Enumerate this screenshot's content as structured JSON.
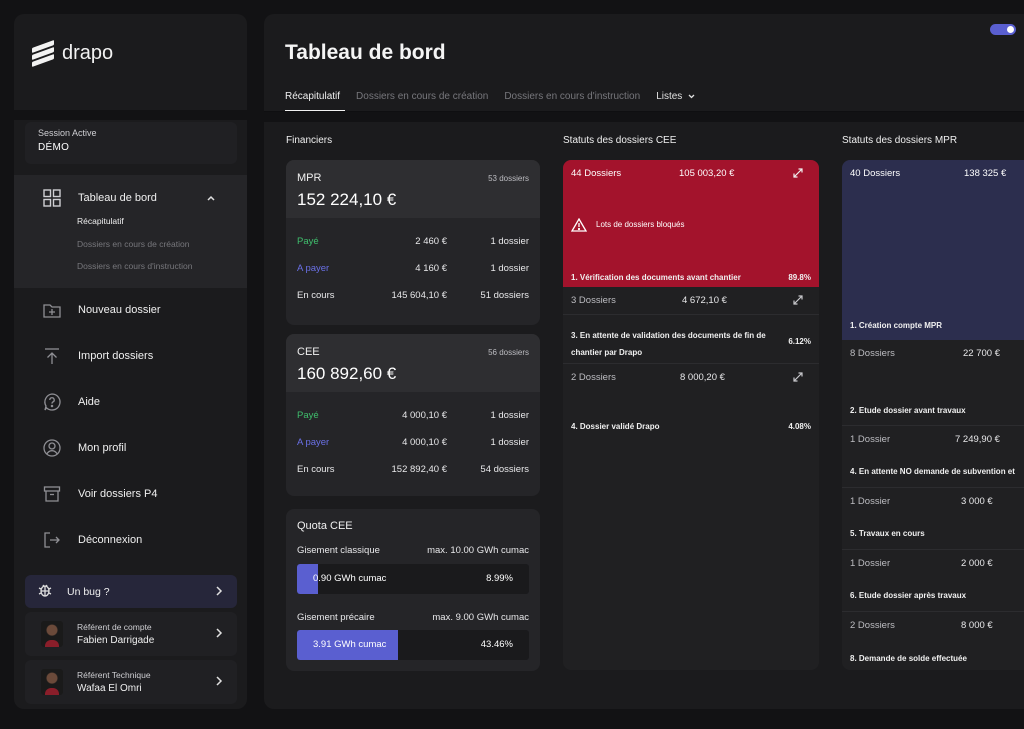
{
  "app": {
    "logo_text": "drapo"
  },
  "session": {
    "label": "Session Active",
    "value": "DÉMO"
  },
  "nav": {
    "dashboard": {
      "label": "Tableau de bord",
      "icon": "grid-icon"
    },
    "sub": [
      "Récapitulatif",
      "Dossiers en cours de création",
      "Dossiers en cours d'instruction"
    ],
    "items": [
      {
        "label": "Nouveau dossier",
        "icon": "folder-plus-icon"
      },
      {
        "label": "Import dossiers",
        "icon": "upload-icon"
      },
      {
        "label": "Aide",
        "icon": "help-icon"
      },
      {
        "label": "Mon profil",
        "icon": "user-icon"
      },
      {
        "label": "Voir dossiers P4",
        "icon": "archive-icon"
      },
      {
        "label": "Déconnexion",
        "icon": "logout-icon"
      }
    ]
  },
  "support": {
    "bug": "Un bug ?",
    "ref_compte": {
      "label": "Référent de compte",
      "name": "Fabien Darrigade"
    },
    "ref_tech": {
      "label": "Référent Technique",
      "name": "Wafaa El Omri"
    }
  },
  "header": {
    "title": "Tableau de bord",
    "tabs": [
      "Récapitulatif",
      "Dossiers en cours de création",
      "Dossiers en cours d'instruction",
      "Listes"
    ],
    "edge_text": "Cr"
  },
  "financiers": {
    "title": "Financiers",
    "cards": [
      {
        "name": "MPR",
        "count": "53 dossiers",
        "total": "152 224,10 €",
        "rows": [
          {
            "label": "Payé",
            "amount": "2 460 €",
            "dossiers": "1 dossier"
          },
          {
            "label": "A payer",
            "amount": "4 160 €",
            "dossiers": "1 dossier"
          },
          {
            "label": "En cours",
            "amount": "145 604,10 €",
            "dossiers": "51 dossiers"
          }
        ]
      },
      {
        "name": "CEE",
        "count": "56 dossiers",
        "total": "160 892,60 €",
        "rows": [
          {
            "label": "Payé",
            "amount": "4 000,10 €",
            "dossiers": "1 dossier"
          },
          {
            "label": "A payer",
            "amount": "4 000,10 €",
            "dossiers": "1 dossier"
          },
          {
            "label": "En cours",
            "amount": "152 892,40 €",
            "dossiers": "54 dossiers"
          }
        ]
      }
    ]
  },
  "quota": {
    "title": "Quota CEE",
    "classique": {
      "label": "Gisement classique",
      "max": "max. 10.00 GWh cumac",
      "value": "0.90 GWh cumac",
      "pct": "8.99%",
      "fraction": 0.0899
    },
    "precaire": {
      "label": "Gisement précaire",
      "max": "max. 9.00 GWh cumac",
      "value": "3.91 GWh cumac",
      "pct": "43.46%",
      "fraction": 0.4346
    }
  },
  "cee_status": {
    "title": "Statuts des dossiers CEE",
    "blocked": "Lots de dossiers bloqués",
    "blocks": [
      {
        "count": "44 Dossiers",
        "amount": "105 003,20 €",
        "label": "1. Vérification des documents avant chantier",
        "pct": "89.8%",
        "color": "#a3132c"
      },
      {
        "count": "3 Dossiers",
        "amount": "4 672,10 €",
        "label": "3. En attente de validation des documents de fin de chantier par Drapo",
        "pct": "6.12%"
      },
      {
        "count": "2 Dossiers",
        "amount": "8 000,20 €",
        "label": "4. Dossier validé Drapo",
        "pct": "4.08%"
      }
    ]
  },
  "mpr_status": {
    "title": "Statuts des dossiers MPR",
    "blocks": [
      {
        "count": "40 Dossiers",
        "amount": "138 325 €",
        "label": "1. Création compte MPR",
        "color": "#2c2e4e"
      },
      {
        "count": "8 Dossiers",
        "amount": "22 700 €",
        "label": "2. Etude dossier avant travaux"
      },
      {
        "count": "1 Dossier",
        "amount": "7 249,90 €",
        "label": "4. En attente NO demande de subvention et"
      },
      {
        "count": "1 Dossier",
        "amount": "3 000 €",
        "label": "5. Travaux en cours"
      },
      {
        "count": "1 Dossier",
        "amount": "2 000 €",
        "label": "6. Etude dossier après travaux"
      },
      {
        "count": "2 Dossiers",
        "amount": "8 000 €",
        "label": "8. Demande de solde effectuée"
      }
    ]
  }
}
